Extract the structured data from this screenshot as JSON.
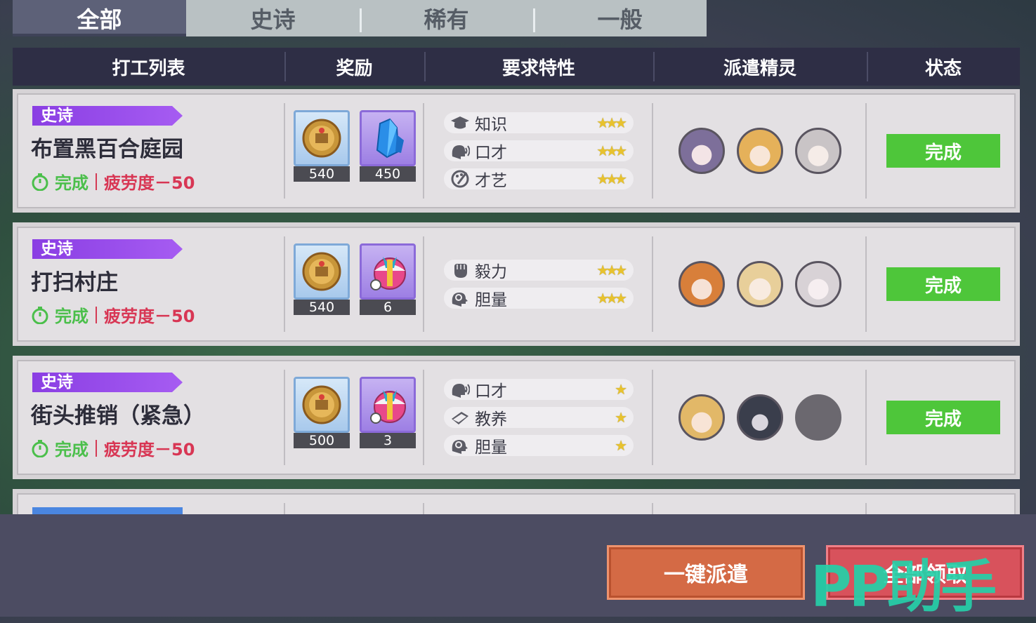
{
  "tabs": [
    "全部",
    "史诗",
    "稀有",
    "一般"
  ],
  "header": [
    "打工列表",
    "奖励",
    "要求特性",
    "派遣精灵",
    "状态"
  ],
  "jobs": [
    {
      "rarity": "史诗",
      "name": "布置黑百合庭园",
      "status_done": "完成",
      "fatigue": "疲劳度－50",
      "rewards": [
        {
          "icon": "gold-coin-icon",
          "count": "540"
        },
        {
          "icon": "blue-crystal-icon",
          "count": "450"
        }
      ],
      "traits": [
        {
          "icon": "graduation-cap-icon",
          "name": "知识",
          "stars": "★★★"
        },
        {
          "icon": "speaking-head-icon",
          "name": "口才",
          "stars": "★★★"
        },
        {
          "icon": "palette-icon",
          "name": "才艺",
          "stars": "★★★"
        }
      ],
      "spirits": [
        "spirit-avatar",
        "spirit-avatar",
        "spirit-avatar"
      ],
      "state": "完成"
    },
    {
      "rarity": "史诗",
      "name": "打扫村庄",
      "status_done": "完成",
      "fatigue": "疲劳度－50",
      "rewards": [
        {
          "icon": "gold-coin-icon",
          "count": "540"
        },
        {
          "icon": "gift-ball-icon",
          "count": "6"
        }
      ],
      "traits": [
        {
          "icon": "fist-icon",
          "name": "毅力",
          "stars": "★★★"
        },
        {
          "icon": "brave-head-icon",
          "name": "胆量",
          "stars": "★★★"
        }
      ],
      "spirits": [
        "spirit-avatar",
        "spirit-avatar",
        "spirit-avatar"
      ],
      "state": "完成"
    },
    {
      "rarity": "史诗",
      "name": "街头推销（紧急）",
      "status_done": "完成",
      "fatigue": "疲劳度－50",
      "rewards": [
        {
          "icon": "gold-coin-icon",
          "count": "500"
        },
        {
          "icon": "gift-ball-icon",
          "count": "3"
        }
      ],
      "traits": [
        {
          "icon": "speaking-head-icon",
          "name": "口才",
          "stars": "★"
        },
        {
          "icon": "book-icon",
          "name": "教养",
          "stars": "★"
        },
        {
          "icon": "brave-head-icon",
          "name": "胆量",
          "stars": "★"
        }
      ],
      "spirits": [
        "spirit-avatar",
        "spirit-avatar",
        "empty-slot"
      ],
      "state": "完成"
    }
  ],
  "buttons": {
    "dispatch": "一键派遣",
    "collect": "全部领取"
  },
  "watermark": "PP助手",
  "colors": {
    "accent_green": "#4ec63a",
    "epic_purple": "#9a4eea",
    "fatigue_red": "#d83654"
  }
}
